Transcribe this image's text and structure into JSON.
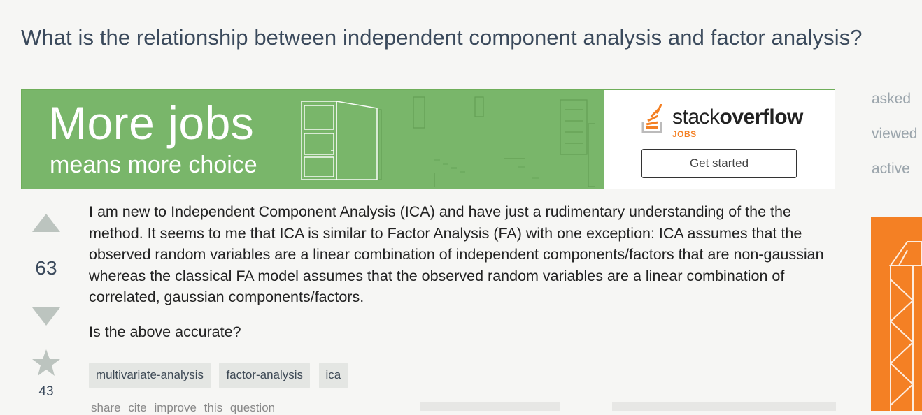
{
  "question": {
    "title": "What is the relationship between independent component analysis and factor analysis?",
    "votes": "63",
    "favorites": "43",
    "body": [
      "I am new to Independent Component Analysis (ICA) and have just a rudimentary understanding of the the method. It seems to me that ICA is similar to Factor Analysis (FA) with one exception: ICA assumes that the observed random variables are a linear combination of independent components/factors that are non-gaussian whereas the classical FA model assumes that the observed random variables are a linear combination of correlated, gaussian components/factors.",
      "Is the above accurate?"
    ],
    "tags": [
      "multivariate-analysis",
      "factor-analysis",
      "ica"
    ],
    "menu": [
      "share",
      "cite",
      "improve this question"
    ]
  },
  "ad": {
    "headline": "More jobs",
    "subline": "means more choice",
    "brand_regular": "stack",
    "brand_bold": "overflow",
    "brand_sub": "JOBS",
    "cta": "Get started",
    "colors": {
      "green": "#79b66a",
      "orange": "#f48024"
    }
  },
  "sidebar": {
    "labels": [
      "asked",
      "viewed",
      "active"
    ]
  }
}
